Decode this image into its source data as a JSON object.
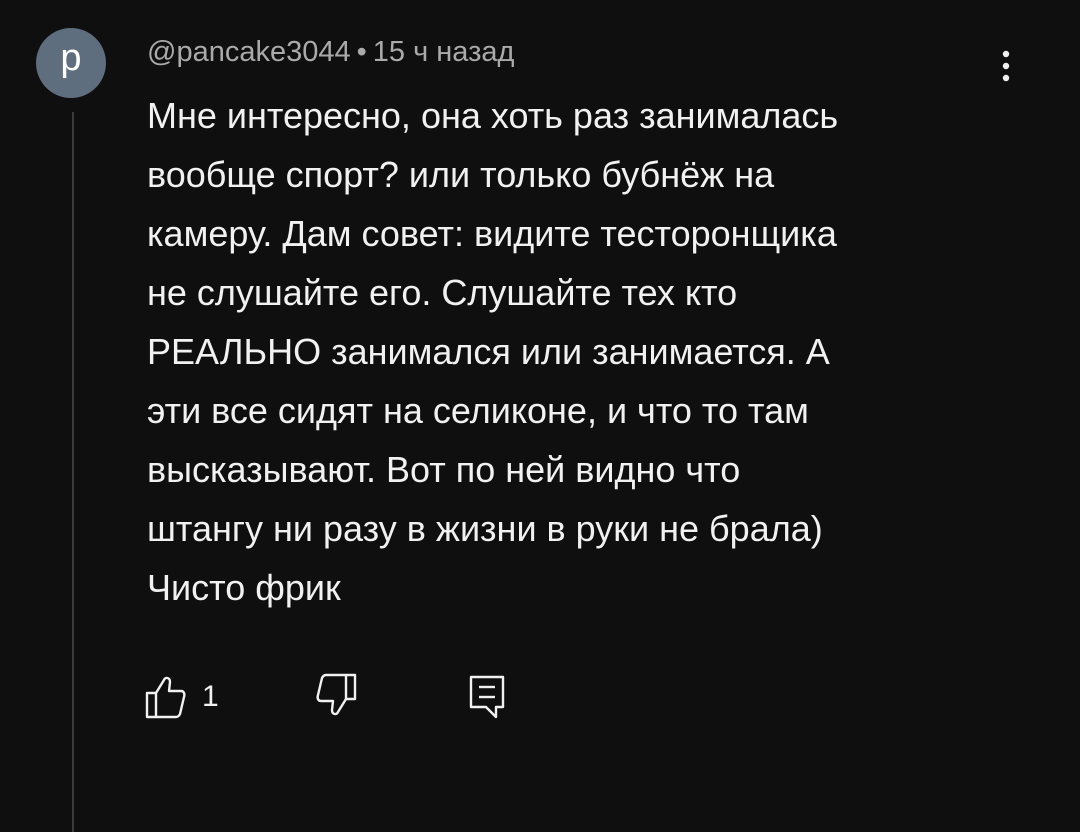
{
  "comment": {
    "avatar_letter": "p",
    "author": "@pancake3044",
    "separator": "•",
    "time": "15 ч назад",
    "lines": [
      "Мне интересно, она хоть раз занималась",
      "вообще спорт? или только бубнёж на",
      "камеру. Дам совет: видите тестоpонщика",
      "не слушайте его. Слушайте тех кто",
      "РЕАЛЬНО занимался или занимается. А",
      "эти все сидят на селиконе, и что то там",
      "высказывают. Вот по ней видно что",
      "штангу ни разу в жизни в руки не брала)",
      "Чисто фрик"
    ],
    "like_count": "1"
  },
  "icons": {
    "more": "more-vert-icon",
    "like": "thumb-up-icon",
    "dislike": "thumb-down-icon",
    "reply": "reply-comment-icon"
  },
  "colors": {
    "background": "#0f0f0f",
    "text": "#f1f1f1",
    "meta_text": "#aaaaaa",
    "avatar_bg": "#5e6e7e"
  }
}
